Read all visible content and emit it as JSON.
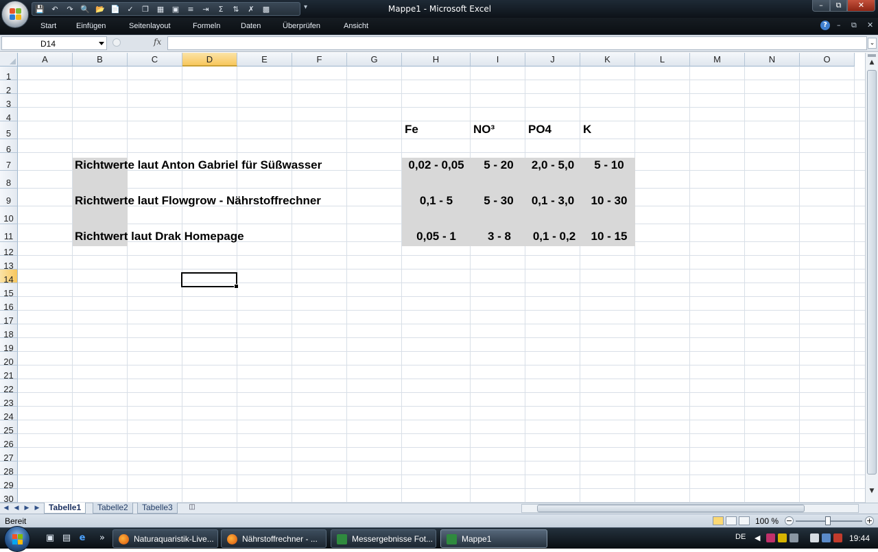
{
  "window": {
    "title": "Mappe1 - Microsoft Excel",
    "minimize": "–",
    "maximize": "⧉",
    "close": "✕"
  },
  "qat_icons": [
    "save-icon",
    "undo-icon",
    "redo-icon",
    "print-preview-icon",
    "open-icon",
    "new-icon",
    "spelling-icon",
    "copy-icon",
    "table-icon",
    "format-icon",
    "align-icon",
    "indent-icon",
    "sum-icon",
    "sort-icon",
    "delete-icon",
    "chart-icon"
  ],
  "ribbon": {
    "tabs": [
      "Start",
      "Einfügen",
      "Seitenlayout",
      "Formeln",
      "Daten",
      "Überprüfen",
      "Ansicht"
    ],
    "help": "?"
  },
  "formula_bar": {
    "name_box": "D14",
    "fx": "fx",
    "formula": ""
  },
  "columns": [
    "A",
    "B",
    "C",
    "D",
    "E",
    "F",
    "G",
    "H",
    "I",
    "J",
    "K",
    "L",
    "M",
    "N",
    "O"
  ],
  "active_column": "D",
  "rows": [
    "1",
    "2",
    "3",
    "4",
    "5",
    "6",
    "7",
    "8",
    "9",
    "10",
    "11",
    "12",
    "13",
    "14",
    "15",
    "16",
    "17",
    "18",
    "19",
    "20",
    "21",
    "22",
    "23",
    "24",
    "25",
    "26",
    "27",
    "28",
    "29",
    "30"
  ],
  "active_row": "14",
  "cells": {
    "h5": "Fe",
    "i5": "NO³",
    "j5": "PO4",
    "k5": "K",
    "b7": "Richtwerte laut Anton Gabriel für Süßwasser",
    "h7": "0,02 - 0,05",
    "i7": "5 - 20",
    "j7": "2,0 - 5,0",
    "k7": "5 - 10",
    "b9": "Richtwerte laut Flowgrow - Nährstoffrechner",
    "h9": "0,1 - 5",
    "i9": "5 - 30",
    "j9": "0,1 - 3,0",
    "k9": "10 - 30",
    "b11": "Richtwert laut Drak Homepage",
    "h11": "0,05 - 1",
    "i11": "3 - 8",
    "j11": "0,1 - 0,2",
    "k11": "10 - 15"
  },
  "fill_color": "#d8d8d8",
  "sheets": {
    "tabs": [
      "Tabelle1",
      "Tabelle2",
      "Tabelle3"
    ],
    "active": "Tabelle1"
  },
  "status": {
    "text": "Bereit",
    "zoom": "100 %"
  },
  "taskbar": {
    "items": [
      {
        "label": "Naturaquaristik-Live...",
        "icon": "firefox-icon"
      },
      {
        "label": "Nährstoffrechner - ...",
        "icon": "firefox-icon"
      },
      {
        "label": "Messergebnisse Fot...",
        "icon": "excel-icon"
      },
      {
        "label": "Mappe1",
        "icon": "excel-icon"
      }
    ],
    "active_item": "Mappe1",
    "language": "DE",
    "clock": "19:44"
  }
}
